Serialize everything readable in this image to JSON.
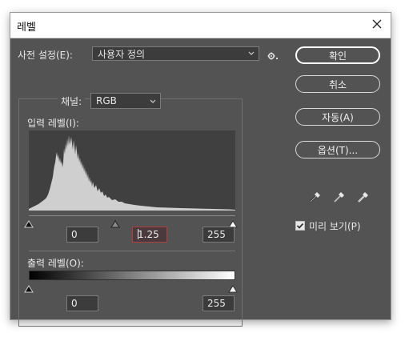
{
  "window": {
    "title": "레벨"
  },
  "preset": {
    "label": "사전 설정(E):",
    "value": "사용자 정의"
  },
  "buttons": {
    "ok": "확인",
    "cancel": "취소",
    "auto": "자동(A)",
    "options": "옵션(T)..."
  },
  "channel": {
    "label": "채널:",
    "value": "RGB"
  },
  "input_levels": {
    "label": "입력 레벨(I):",
    "black": "0",
    "gamma": "1.25",
    "white": "255"
  },
  "output_levels": {
    "label": "출력 레벨(O):",
    "black": "0",
    "white": "255"
  },
  "preview": {
    "label": "미리 보기(P)",
    "checked": true
  },
  "icons": {
    "close": "close-icon",
    "gear": "gear-icon",
    "chevron": "chevron-down-icon",
    "black_dropper": "black-eyedropper-icon",
    "gray_dropper": "gray-eyedropper-icon",
    "white_dropper": "white-eyedropper-icon",
    "check": "check-icon"
  }
}
